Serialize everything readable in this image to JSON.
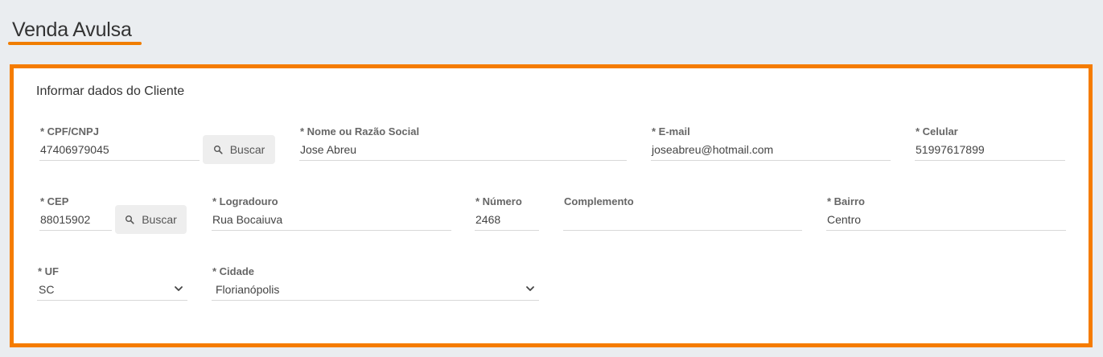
{
  "page": {
    "title": "Venda Avulsa"
  },
  "section": {
    "title": "Informar dados do Cliente"
  },
  "fields": {
    "cpf_cnpj": {
      "label": "* CPF/CNPJ",
      "value": "47406979045"
    },
    "nome": {
      "label": "* Nome ou Razão Social",
      "value": "Jose Abreu"
    },
    "email": {
      "label": "* E-mail",
      "value": "joseabreu@hotmail.com"
    },
    "celular": {
      "label": "* Celular",
      "value": "51997617899"
    },
    "cep": {
      "label": "* CEP",
      "value": "88015902"
    },
    "logradouro": {
      "label": "* Logradouro",
      "value": "Rua Bocaiuva"
    },
    "numero": {
      "label": "* Número",
      "value": "2468"
    },
    "complemento": {
      "label": "Complemento",
      "value": ""
    },
    "bairro": {
      "label": "* Bairro",
      "value": "Centro"
    },
    "uf": {
      "label": "* UF",
      "value": "SC"
    },
    "cidade": {
      "label": "* Cidade",
      "value": "Florianópolis"
    }
  },
  "buttons": {
    "buscar_cpf": "Buscar",
    "buscar_cep": "Buscar"
  },
  "icons": {
    "search": "search-icon",
    "dropdown": "chevron-down-icon"
  },
  "colors": {
    "accent": "#f57c00",
    "background": "#eaedf0",
    "card": "#ffffff",
    "button": "#eeeeee"
  }
}
